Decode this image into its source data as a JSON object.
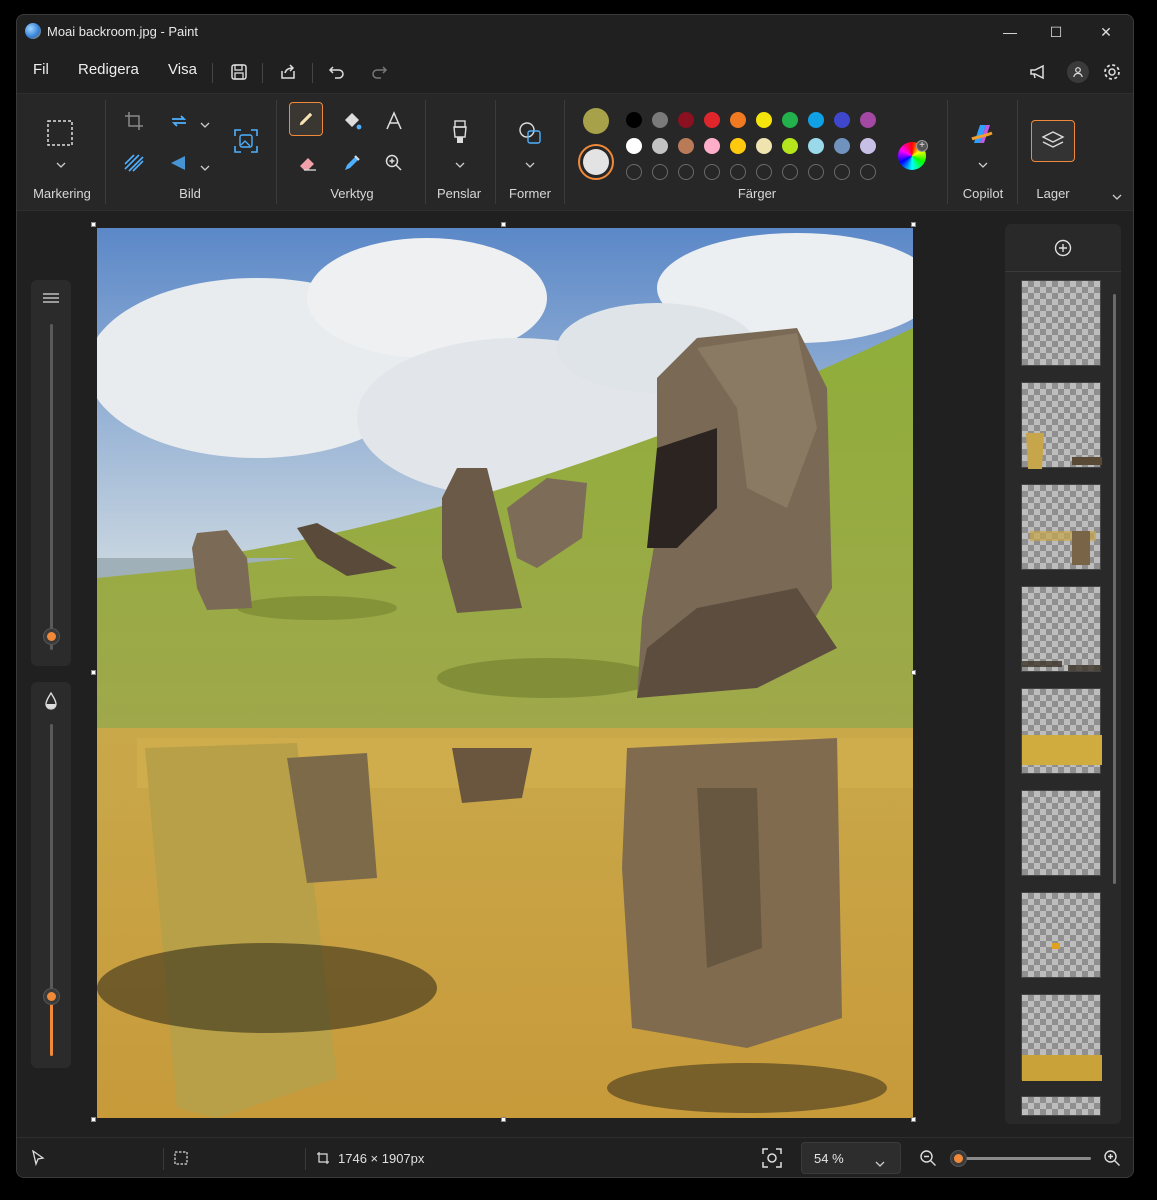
{
  "window": {
    "title": "Moai backroom.jpg - Paint",
    "minimize": "—",
    "maximize": "☐",
    "close": "✕"
  },
  "menu": {
    "file": "Fil",
    "edit": "Redigera",
    "view": "Visa"
  },
  "ribbon": {
    "groups": {
      "selection": "Markering",
      "image": "Bild",
      "tools": "Verktyg",
      "brushes": "Penslar",
      "shapes": "Former",
      "colors": "Färger",
      "copilot": "Copilot",
      "layers": "Lager"
    }
  },
  "colors": {
    "primary": "#a7a24a",
    "secondary": "#e3e3e3",
    "accent": "#f08a3a",
    "row1": [
      "#000000",
      "#7a7a7a",
      "#8b1020",
      "#e0262d",
      "#f07a22",
      "#f5e30c",
      "#22b14c",
      "#10a0e6",
      "#3f48cc",
      "#a349a4"
    ],
    "row2": [
      "#ffffff",
      "#c3c3c3",
      "#b97a57",
      "#ffaec9",
      "#ffc90e",
      "#efe4b0",
      "#b5e61d",
      "#99d9ea",
      "#7092be",
      "#c8bfe7"
    ]
  },
  "sliders": {
    "size_level": 0.0,
    "opacity_level": 0.18
  },
  "status": {
    "dimensions": "1746 × 1907px",
    "zoom": "54 %",
    "zoom_level": 0.05
  }
}
